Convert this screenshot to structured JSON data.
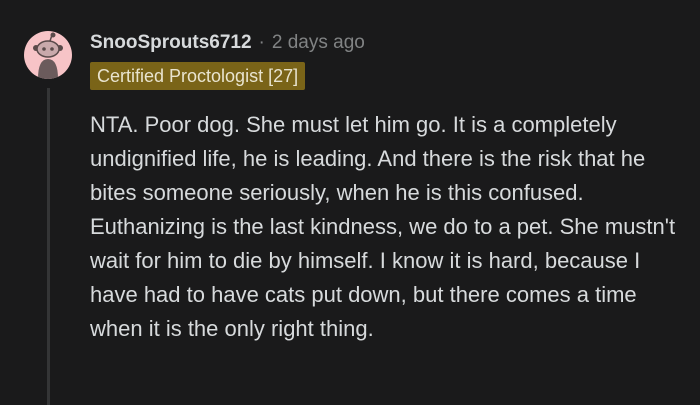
{
  "comment": {
    "author": "SnooSprouts6712",
    "separator": "·",
    "time_ago": "2 days ago",
    "flair": "Certified Proctologist [27]",
    "body": "NTA. Poor dog. She must let him go. It is a completely undignified life, he is leading. And there is the risk that he bites someone seriously, when he is this confused. Euthanizing is the last kindness, we do to a pet. She mustn't wait for him to die by himself. I know it is hard, because I have had to have cats put down, but there comes a time when it is the only right thing."
  },
  "avatar": {
    "icon": "snoo-avatar-icon",
    "background_color": "#f7c4c7"
  },
  "colors": {
    "background": "#1a1a1b",
    "text": "#d7dadc",
    "muted": "#818384",
    "flair_background": "#7a6418",
    "thread_line": "#343536"
  }
}
